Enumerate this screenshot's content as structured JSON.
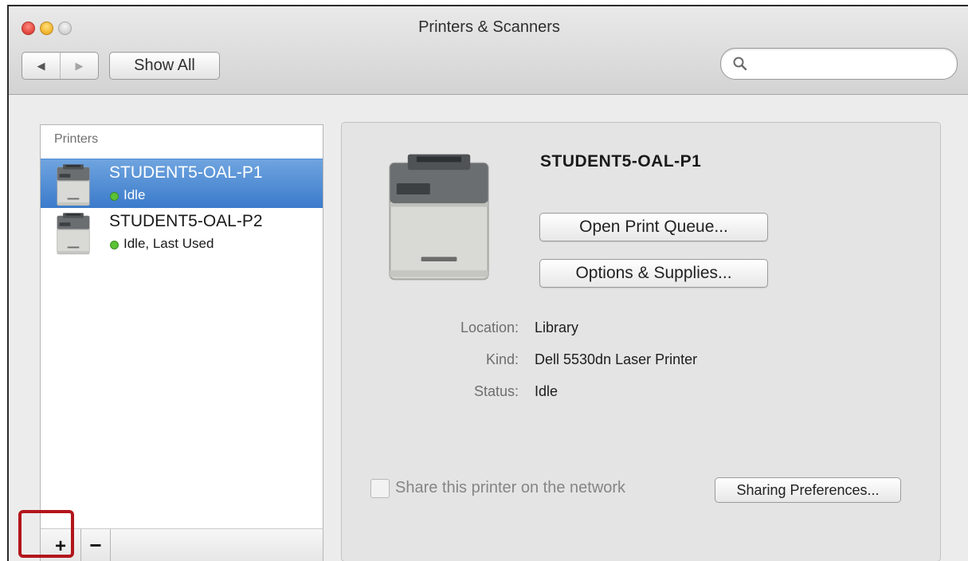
{
  "window": {
    "title": "Printers & Scanners"
  },
  "toolbar": {
    "back_icon": "◀",
    "forward_icon": "▶",
    "show_all_label": "Show All",
    "search": {
      "value": "",
      "placeholder": ""
    }
  },
  "sidebar": {
    "header": "Printers",
    "items": [
      {
        "name": "STUDENT5-OAL-P1",
        "status": "Idle",
        "selected": true
      },
      {
        "name": "STUDENT5-OAL-P2",
        "status": "Idle, Last Used",
        "selected": false
      }
    ],
    "add_label": "+",
    "remove_label": "−"
  },
  "detail": {
    "name": "STUDENT5-OAL-P1",
    "open_queue_label": "Open Print Queue...",
    "options_label": "Options & Supplies...",
    "location_label": "Location:",
    "location_value": "Library",
    "kind_label": "Kind:",
    "kind_value": "Dell 5530dn Laser Printer",
    "status_label": "Status:",
    "status_value": "Idle",
    "share_label": "Share this printer on the network",
    "sharing_pref_label": "Sharing Preferences..."
  },
  "colors": {
    "selection": "#3b7bcb",
    "status_dot": "#5bc236",
    "highlight": "#b2161b"
  }
}
